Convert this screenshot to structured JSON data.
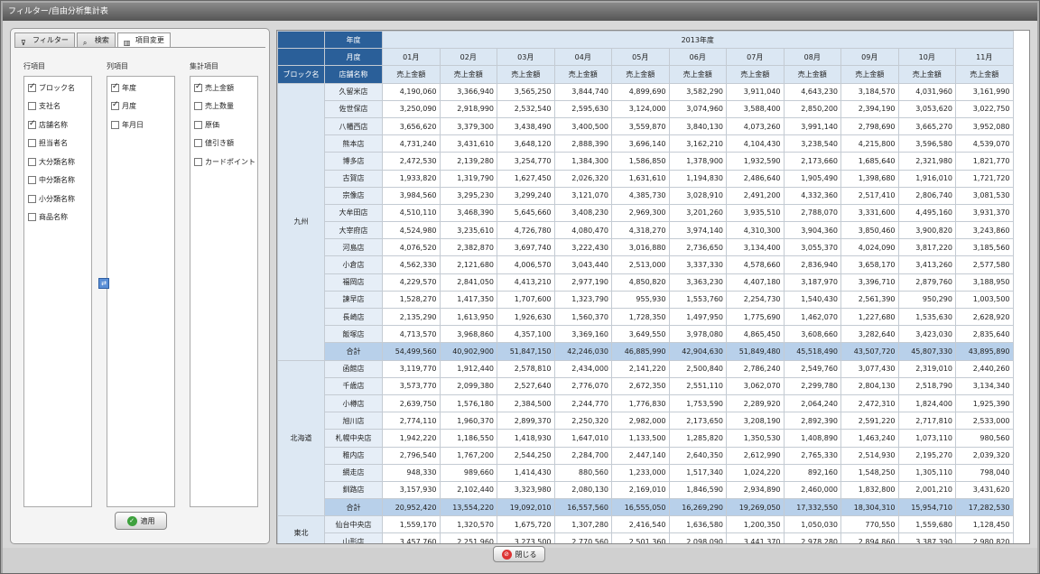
{
  "window": {
    "title": "フィルター/自由分析集計表"
  },
  "tabs": [
    {
      "label": "フィルター",
      "icon": "filter-icon"
    },
    {
      "label": "検索",
      "icon": "search-icon"
    },
    {
      "label": "項目変更",
      "icon": "columns-icon"
    }
  ],
  "groups": {
    "rows": {
      "label": "行項目",
      "items": [
        {
          "label": "ブロック名",
          "checked": true
        },
        {
          "label": "支社名",
          "checked": false
        },
        {
          "label": "店舗名称",
          "checked": true
        },
        {
          "label": "担当者名",
          "checked": false
        },
        {
          "label": "大分類名称",
          "checked": false
        },
        {
          "label": "中分類名称",
          "checked": false
        },
        {
          "label": "小分類名称",
          "checked": false
        },
        {
          "label": "商品名称",
          "checked": false
        }
      ]
    },
    "cols": {
      "label": "列項目",
      "items": [
        {
          "label": "年度",
          "checked": true
        },
        {
          "label": "月度",
          "checked": true
        },
        {
          "label": "年月日",
          "checked": false
        }
      ]
    },
    "agg": {
      "label": "集計項目",
      "items": [
        {
          "label": "売上金額",
          "checked": true
        },
        {
          "label": "売上数量",
          "checked": false
        },
        {
          "label": "原価",
          "checked": false
        },
        {
          "label": "値引き額",
          "checked": false
        },
        {
          "label": "カードポイント",
          "checked": false
        }
      ]
    }
  },
  "buttons": {
    "apply": "適用",
    "close": "閉じる"
  },
  "grid": {
    "year_header": "年度",
    "month_header": "月度",
    "block_header": "ブロック名",
    "store_header": "店舗名称",
    "year_value": "2013年度",
    "months": [
      "01月",
      "02月",
      "03月",
      "04月",
      "05月",
      "06月",
      "07月",
      "08月",
      "09月",
      "10月",
      "11月"
    ],
    "measure": "売上金額",
    "blocks": [
      {
        "name": "九州",
        "rows": [
          {
            "store": "久留米店",
            "values": [
              "4,190,060",
              "3,366,940",
              "3,565,250",
              "3,844,740",
              "4,899,690",
              "3,582,290",
              "3,911,040",
              "4,643,230",
              "3,184,570",
              "4,031,960",
              "3,161,990"
            ]
          },
          {
            "store": "佐世保店",
            "values": [
              "3,250,090",
              "2,918,990",
              "2,532,540",
              "2,595,630",
              "3,124,000",
              "3,074,960",
              "3,588,400",
              "2,850,200",
              "2,394,190",
              "3,053,620",
              "3,022,750"
            ]
          },
          {
            "store": "八幡西店",
            "values": [
              "3,656,620",
              "3,379,300",
              "3,438,490",
              "3,400,500",
              "3,559,870",
              "3,840,130",
              "4,073,260",
              "3,991,140",
              "2,798,690",
              "3,665,270",
              "3,952,080"
            ]
          },
          {
            "store": "熊本店",
            "values": [
              "4,731,240",
              "3,431,610",
              "3,648,120",
              "2,888,390",
              "3,696,140",
              "3,162,210",
              "4,104,430",
              "3,238,540",
              "4,215,800",
              "3,596,580",
              "4,539,070"
            ]
          },
          {
            "store": "博多店",
            "values": [
              "2,472,530",
              "2,139,280",
              "3,254,770",
              "1,384,300",
              "1,586,850",
              "1,378,900",
              "1,932,590",
              "2,173,660",
              "1,685,640",
              "2,321,980",
              "1,821,770"
            ]
          },
          {
            "store": "古賀店",
            "values": [
              "1,933,820",
              "1,319,790",
              "1,627,450",
              "2,026,320",
              "1,631,610",
              "1,194,830",
              "2,486,640",
              "1,905,490",
              "1,398,680",
              "1,916,010",
              "1,721,720"
            ]
          },
          {
            "store": "宗像店",
            "values": [
              "3,984,560",
              "3,295,230",
              "3,299,240",
              "3,121,070",
              "4,385,730",
              "3,028,910",
              "2,491,200",
              "4,332,360",
              "2,517,410",
              "2,806,740",
              "3,081,530"
            ]
          },
          {
            "store": "大牟田店",
            "values": [
              "4,510,110",
              "3,468,390",
              "5,645,660",
              "3,408,230",
              "2,969,300",
              "3,201,260",
              "3,935,510",
              "2,788,070",
              "3,331,600",
              "4,495,160",
              "3,931,370"
            ]
          },
          {
            "store": "大宰府店",
            "values": [
              "4,524,980",
              "3,235,610",
              "4,726,780",
              "4,080,470",
              "4,318,270",
              "3,974,140",
              "4,310,300",
              "3,904,360",
              "3,850,460",
              "3,900,820",
              "3,243,860"
            ]
          },
          {
            "store": "河島店",
            "values": [
              "4,076,520",
              "2,382,870",
              "3,697,740",
              "3,222,430",
              "3,016,880",
              "2,736,650",
              "3,134,400",
              "3,055,370",
              "4,024,090",
              "3,817,220",
              "3,185,560"
            ]
          },
          {
            "store": "小倉店",
            "values": [
              "4,562,330",
              "2,121,680",
              "4,006,570",
              "3,043,440",
              "2,513,000",
              "3,337,330",
              "4,578,660",
              "2,836,940",
              "3,658,170",
              "3,413,260",
              "2,577,580"
            ]
          },
          {
            "store": "福岡店",
            "values": [
              "4,229,570",
              "2,841,050",
              "4,413,210",
              "2,977,190",
              "4,850,820",
              "3,363,230",
              "4,407,180",
              "3,187,970",
              "3,396,710",
              "2,879,760",
              "3,188,950"
            ]
          },
          {
            "store": "諫早店",
            "values": [
              "1,528,270",
              "1,417,350",
              "1,707,600",
              "1,323,790",
              "955,930",
              "1,553,760",
              "2,254,730",
              "1,540,430",
              "2,561,390",
              "950,290",
              "1,003,500"
            ]
          },
          {
            "store": "長崎店",
            "values": [
              "2,135,290",
              "1,613,950",
              "1,926,630",
              "1,560,370",
              "1,728,350",
              "1,497,950",
              "1,775,690",
              "1,462,070",
              "1,227,680",
              "1,535,630",
              "2,628,920"
            ]
          },
          {
            "store": "飯塚店",
            "values": [
              "4,713,570",
              "3,968,860",
              "4,357,100",
              "3,369,160",
              "3,649,550",
              "3,978,080",
              "4,865,450",
              "3,608,660",
              "3,282,640",
              "3,423,030",
              "2,835,640"
            ]
          }
        ],
        "total": {
          "label": "合計",
          "values": [
            "54,499,560",
            "40,902,900",
            "51,847,150",
            "42,246,030",
            "46,885,990",
            "42,904,630",
            "51,849,480",
            "45,518,490",
            "43,507,720",
            "45,807,330",
            "43,895,890"
          ]
        }
      },
      {
        "name": "北海道",
        "rows": [
          {
            "store": "函館店",
            "values": [
              "3,119,770",
              "1,912,440",
              "2,578,810",
              "2,434,000",
              "2,141,220",
              "2,500,840",
              "2,786,240",
              "2,549,760",
              "3,077,430",
              "2,319,010",
              "2,440,260"
            ]
          },
          {
            "store": "千歳店",
            "values": [
              "3,573,770",
              "2,099,380",
              "2,527,640",
              "2,776,070",
              "2,672,350",
              "2,551,110",
              "3,062,070",
              "2,299,780",
              "2,804,130",
              "2,518,790",
              "3,134,340"
            ]
          },
          {
            "store": "小樽店",
            "values": [
              "2,639,750",
              "1,576,180",
              "2,384,500",
              "2,244,770",
              "1,776,830",
              "1,753,590",
              "2,289,920",
              "2,064,240",
              "2,472,310",
              "1,824,400",
              "1,925,390"
            ]
          },
          {
            "store": "旭川店",
            "values": [
              "2,774,110",
              "1,960,370",
              "2,899,370",
              "2,250,320",
              "2,982,000",
              "2,173,650",
              "3,208,190",
              "2,892,390",
              "2,591,220",
              "2,717,810",
              "2,533,000"
            ]
          },
          {
            "store": "札幌中央店",
            "values": [
              "1,942,220",
              "1,186,550",
              "1,418,930",
              "1,647,010",
              "1,133,500",
              "1,285,820",
              "1,350,530",
              "1,408,890",
              "1,463,240",
              "1,073,110",
              "980,560"
            ]
          },
          {
            "store": "稚内店",
            "values": [
              "2,796,540",
              "1,767,200",
              "2,544,250",
              "2,284,700",
              "2,447,140",
              "2,640,350",
              "2,612,990",
              "2,765,330",
              "2,514,930",
              "2,195,270",
              "2,039,320"
            ]
          },
          {
            "store": "網走店",
            "values": [
              "948,330",
              "989,660",
              "1,414,430",
              "880,560",
              "1,233,000",
              "1,517,340",
              "1,024,220",
              "892,160",
              "1,548,250",
              "1,305,110",
              "798,040"
            ]
          },
          {
            "store": "釧路店",
            "values": [
              "3,157,930",
              "2,102,440",
              "3,323,980",
              "2,080,130",
              "2,169,010",
              "1,846,590",
              "2,934,890",
              "2,460,000",
              "1,832,800",
              "2,001,210",
              "3,431,620"
            ]
          }
        ],
        "total": {
          "label": "合計",
          "values": [
            "20,952,420",
            "13,554,220",
            "19,092,010",
            "16,557,560",
            "16,555,050",
            "16,269,290",
            "19,269,050",
            "17,332,550",
            "18,304,310",
            "15,954,710",
            "17,282,530"
          ]
        }
      },
      {
        "name": "東北",
        "rows": [
          {
            "store": "仙台中央店",
            "values": [
              "1,559,170",
              "1,320,570",
              "1,675,720",
              "1,307,280",
              "2,416,540",
              "1,636,580",
              "1,200,350",
              "1,050,030",
              "770,550",
              "1,559,680",
              "1,128,450"
            ]
          },
          {
            "store": "山形店",
            "values": [
              "3,457,760",
              "2,251,960",
              "3,273,500",
              "2,770,560",
              "2,501,360",
              "2,098,090",
              "3,441,370",
              "2,978,280",
              "2,894,860",
              "3,387,390",
              "2,980,820"
            ]
          }
        ]
      }
    ]
  }
}
